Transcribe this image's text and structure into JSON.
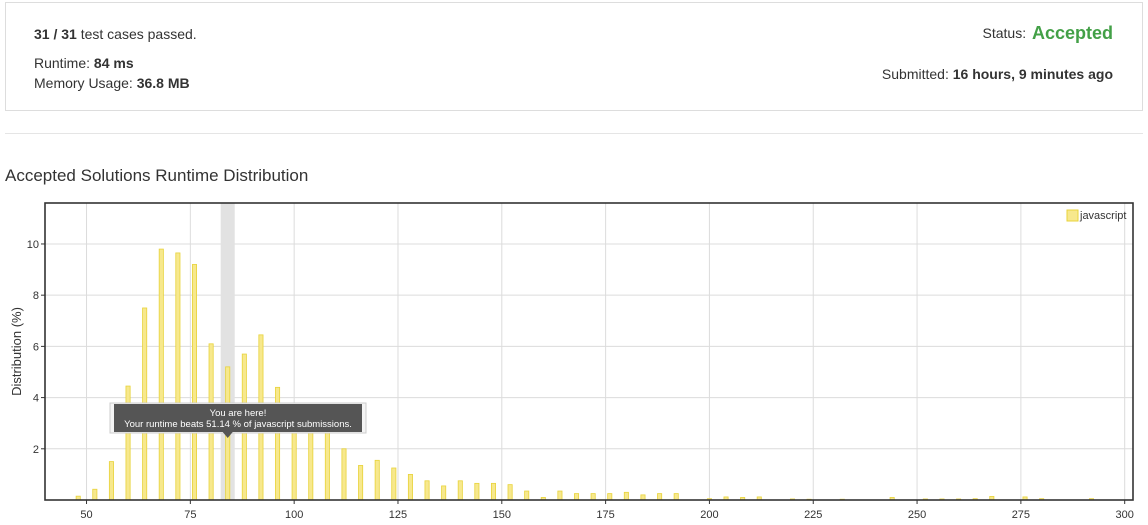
{
  "summary": {
    "cases_count": "31 / 31",
    "cases_text": " test cases passed.",
    "runtime_label": "Runtime: ",
    "runtime_value": "84 ms",
    "memory_label": "Memory Usage: ",
    "memory_value": "36.8 MB",
    "status_label": "Status: ",
    "status_value": "Accepted",
    "submitted_label": "Submitted: ",
    "submitted_value": "16 hours, 9 minutes ago"
  },
  "colors": {
    "accepted": "#43a047",
    "bar_fill": "#f7e88d",
    "bar_stroke": "#e8d33a",
    "highlight": "#e2e2e2",
    "tooltip_bg": "#555555"
  },
  "chart_data": {
    "type": "bar",
    "title": "Accepted Solutions Runtime Distribution",
    "xlabel": "",
    "ylabel": "Distribution (%)",
    "xlim": [
      40,
      302
    ],
    "ylim": [
      0,
      11.6
    ],
    "xticks": [
      50,
      75,
      100,
      125,
      150,
      175,
      200,
      225,
      250,
      275,
      300
    ],
    "yticks": [
      2,
      4,
      6,
      8,
      10
    ],
    "grid": true,
    "legend": {
      "position": "top-right",
      "entries": [
        "javascript"
      ]
    },
    "highlight_x": 84,
    "tooltip": {
      "line1": "You are here!",
      "line2": "Your runtime beats 51.14 % of javascript submissions."
    },
    "series": [
      {
        "name": "javascript",
        "x": [
          48,
          52,
          56,
          60,
          64,
          68,
          72,
          76,
          80,
          84,
          88,
          92,
          96,
          100,
          104,
          108,
          112,
          116,
          120,
          124,
          128,
          132,
          136,
          140,
          144,
          148,
          152,
          156,
          160,
          164,
          168,
          172,
          176,
          180,
          184,
          188,
          192,
          200,
          204,
          208,
          212,
          220,
          224,
          232,
          244,
          252,
          256,
          260,
          264,
          268,
          276,
          280,
          292
        ],
        "values": [
          0.15,
          0.42,
          1.5,
          4.45,
          7.5,
          9.8,
          9.65,
          9.2,
          6.1,
          5.2,
          5.7,
          6.45,
          4.4,
          3.7,
          3.0,
          2.7,
          2.0,
          1.35,
          1.55,
          1.25,
          1.0,
          0.75,
          0.55,
          0.75,
          0.65,
          0.65,
          0.6,
          0.35,
          0.1,
          0.35,
          0.25,
          0.25,
          0.25,
          0.3,
          0.2,
          0.25,
          0.25,
          0.05,
          0.12,
          0.1,
          0.12,
          0.04,
          0.03,
          0.03,
          0.1,
          0.04,
          0.04,
          0.04,
          0.05,
          0.14,
          0.12,
          0.05,
          0.05
        ]
      }
    ]
  }
}
